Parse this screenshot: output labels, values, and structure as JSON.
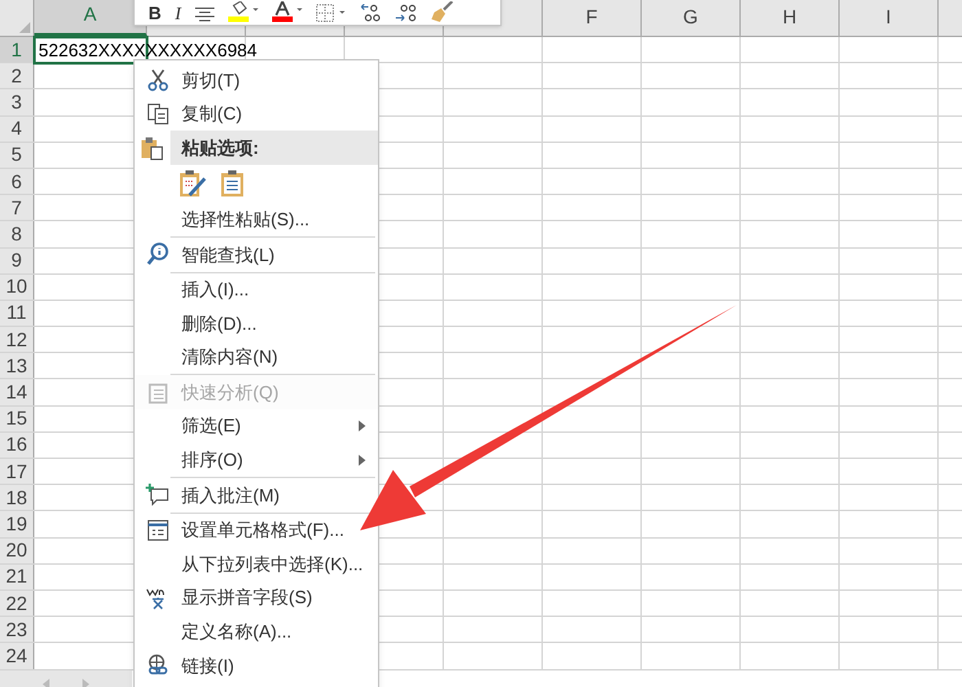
{
  "toolbar": {
    "bold_label": "B",
    "italic_label": "I"
  },
  "sheet": {
    "columns": [
      {
        "label": "A",
        "selected": true
      },
      {
        "selected": false
      },
      {
        "selected": false
      },
      {
        "selected": false
      },
      {
        "selected": false
      },
      {
        "label": "F",
        "selected": false
      },
      {
        "label": "G",
        "selected": false
      },
      {
        "label": "H",
        "selected": false
      },
      {
        "label": "I",
        "selected": false
      }
    ],
    "rows": [
      {
        "label": "1",
        "selected": true
      },
      {
        "label": "2",
        "selected": false
      },
      {
        "label": "3",
        "selected": false
      },
      {
        "label": "4",
        "selected": false
      },
      {
        "label": "5",
        "selected": false
      },
      {
        "label": "6",
        "selected": false
      },
      {
        "label": "7",
        "selected": false
      },
      {
        "label": "8",
        "selected": false
      },
      {
        "label": "9",
        "selected": false
      },
      {
        "label": "10",
        "selected": false
      },
      {
        "label": "11",
        "selected": false
      },
      {
        "label": "12",
        "selected": false
      },
      {
        "label": "13",
        "selected": false
      },
      {
        "label": "14",
        "selected": false
      },
      {
        "label": "15",
        "selected": false
      },
      {
        "label": "16",
        "selected": false
      },
      {
        "label": "17",
        "selected": false
      },
      {
        "label": "18",
        "selected": false
      },
      {
        "label": "19",
        "selected": false
      },
      {
        "label": "20",
        "selected": false
      },
      {
        "label": "21",
        "selected": false
      },
      {
        "label": "22",
        "selected": false
      },
      {
        "label": "23",
        "selected": false
      },
      {
        "label": "24",
        "selected": false
      }
    ],
    "cell_a1": "522632XXXXXXXXXX6984"
  },
  "context_menu": [
    {
      "kind": "item",
      "label": "剪切(T)",
      "disabled": false,
      "submenu": false
    },
    {
      "kind": "item",
      "label": "复制(C)",
      "disabled": false,
      "submenu": false
    },
    {
      "kind": "header",
      "label": "粘贴选项:"
    },
    {
      "kind": "paste_icons"
    },
    {
      "kind": "item",
      "label": "选择性粘贴(S)...",
      "disabled": false,
      "submenu": false
    },
    {
      "kind": "separator"
    },
    {
      "kind": "item",
      "label": "智能查找(L)",
      "disabled": false,
      "submenu": false
    },
    {
      "kind": "separator"
    },
    {
      "kind": "item",
      "label": "插入(I)...",
      "disabled": false,
      "submenu": false
    },
    {
      "kind": "item",
      "label": "删除(D)...",
      "disabled": false,
      "submenu": false
    },
    {
      "kind": "item",
      "label": "清除内容(N)",
      "disabled": false,
      "submenu": false
    },
    {
      "kind": "separator"
    },
    {
      "kind": "item",
      "label": "快速分析(Q)",
      "disabled": true,
      "submenu": false
    },
    {
      "kind": "item",
      "label": "筛选(E)",
      "disabled": false,
      "submenu": true
    },
    {
      "kind": "item",
      "label": "排序(O)",
      "disabled": false,
      "submenu": true
    },
    {
      "kind": "separator"
    },
    {
      "kind": "item",
      "label": "插入批注(M)",
      "disabled": false,
      "submenu": false
    },
    {
      "kind": "separator"
    },
    {
      "kind": "item",
      "label": "设置单元格格式(F)...",
      "disabled": false,
      "submenu": false
    },
    {
      "kind": "item",
      "label": "从下拉列表中选择(K)...",
      "disabled": false,
      "submenu": false
    },
    {
      "kind": "item",
      "label": "显示拼音字段(S)",
      "disabled": false,
      "submenu": false
    },
    {
      "kind": "item",
      "label": "定义名称(A)...",
      "disabled": false,
      "submenu": false
    },
    {
      "kind": "item",
      "label": "链接(I)",
      "disabled": false,
      "submenu": false
    }
  ]
}
